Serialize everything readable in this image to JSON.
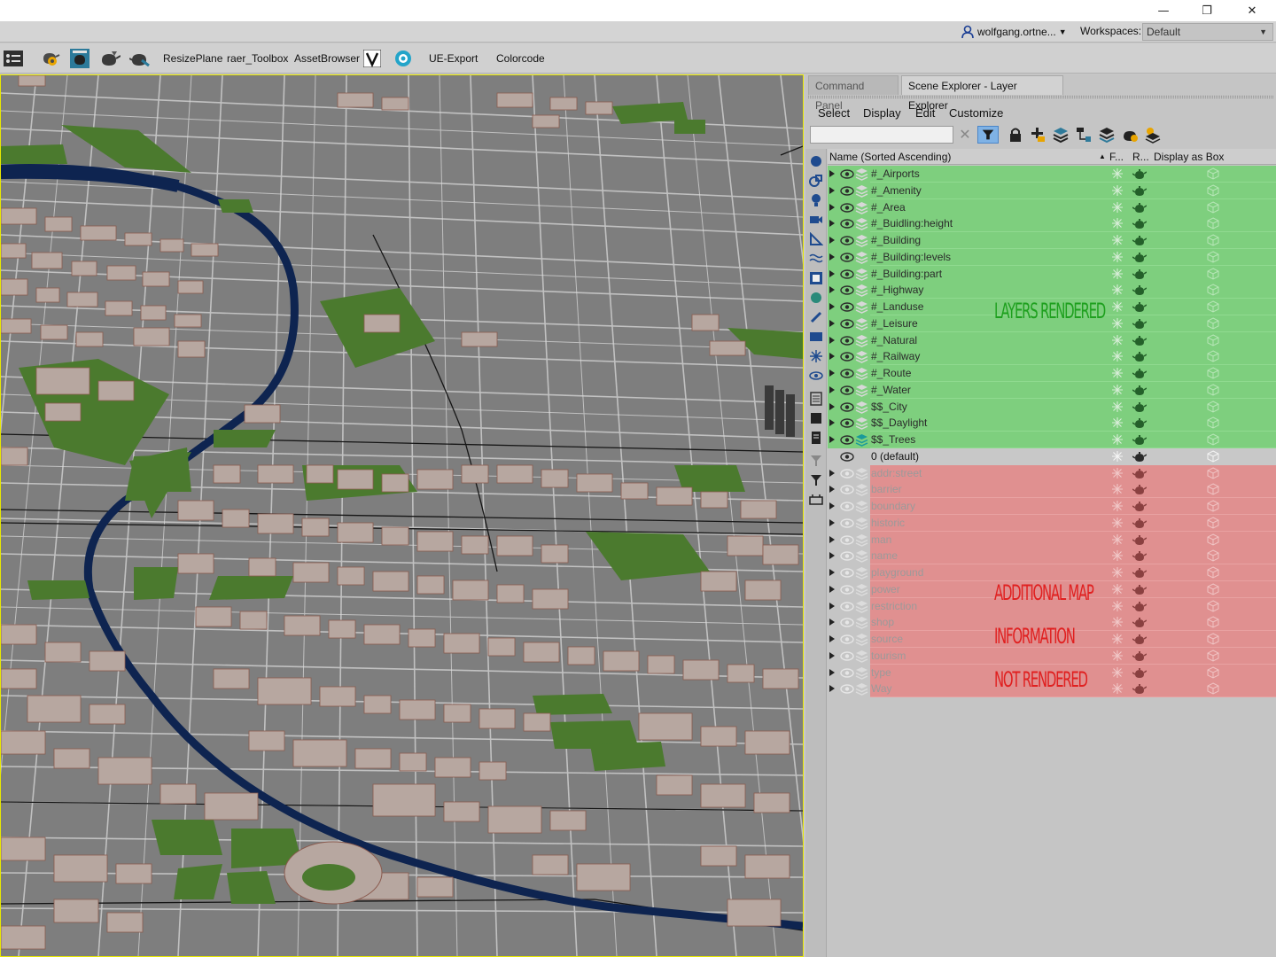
{
  "window": {
    "minimize_label": "—",
    "restore_label": "❐",
    "close_label": "✕"
  },
  "userbar": {
    "user": "wolfgang.ortne...",
    "workspaces_label": "Workspaces:",
    "workspace_value": "Default"
  },
  "toolbar": {
    "items": [
      "ResizePlane",
      "raer_Toolbox",
      "AssetBrowser",
      "UE-Export",
      "Colorcode"
    ]
  },
  "panel": {
    "tabs": [
      "Command Panel",
      "Scene Explorer - Layer Explorer"
    ],
    "menu": [
      "Select",
      "Display",
      "Edit",
      "Customize"
    ],
    "search_value": "",
    "columns": {
      "name": "Name (Sorted Ascending)",
      "sort_arrow": "▲",
      "frozen": "F...",
      "render": "R...",
      "display_box": "Display as Box"
    }
  },
  "layers_rendered": [
    "#_Airports",
    "#_Amenity",
    "#_Area",
    "#_Buidling:height",
    "#_Building",
    "#_Building:levels",
    "#_Building:part",
    "#_Highway",
    "#_Landuse",
    "#_Leisure",
    "#_Natural",
    "#_Railway",
    "#_Route",
    "#_Water",
    "$$_City",
    "$$_Daylight",
    "$$_Trees"
  ],
  "layer_default": "0 (default)",
  "layers_not_rendered": [
    "addr:street",
    "barrier",
    "boundary",
    "historic",
    "man",
    "name",
    "playground",
    "power",
    "restriction",
    "shop",
    "source",
    "tourism",
    "type",
    "Way"
  ],
  "annotations": {
    "rendered": "LAYERS RENDERED",
    "not_rendered_1": "ADDITIONAL MAP",
    "not_rendered_2": "INFORMATION",
    "not_rendered_3": "NOT RENDERED"
  },
  "colors": {
    "rendered_bg": "#7ecf7e",
    "not_rendered_bg": "#e09090",
    "annotation_green": "#1ea01e",
    "annotation_red": "#e02020",
    "viewport_border": "#e8e800",
    "river": "#0e2450"
  }
}
